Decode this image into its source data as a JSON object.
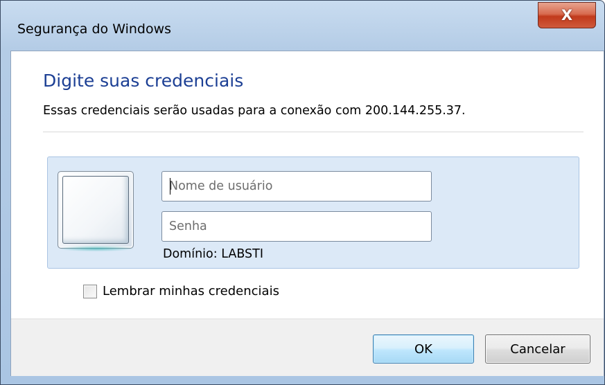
{
  "window": {
    "title": "Segurança do Windows",
    "close_glyph": "X"
  },
  "header": {
    "heading": "Digite suas credenciais",
    "description": "Essas credenciais serão usadas para a conexão com 200.144.255.37."
  },
  "credentials": {
    "tile_icon": "user-tile-icon",
    "username": {
      "value": "",
      "placeholder": "Nome de usuário"
    },
    "password": {
      "value": "",
      "placeholder": "Senha"
    },
    "domain_label": "Domínio: LABSTI"
  },
  "remember": {
    "label": "Lembrar minhas credenciais",
    "checked": false
  },
  "buttons": {
    "ok_label": "OK",
    "cancel_label": "Cancelar"
  },
  "colors": {
    "heading": "#1c3f94",
    "panel": "#dce9f7",
    "close_button": "#c13a1c",
    "default_button_border": "#3c7fb1"
  }
}
